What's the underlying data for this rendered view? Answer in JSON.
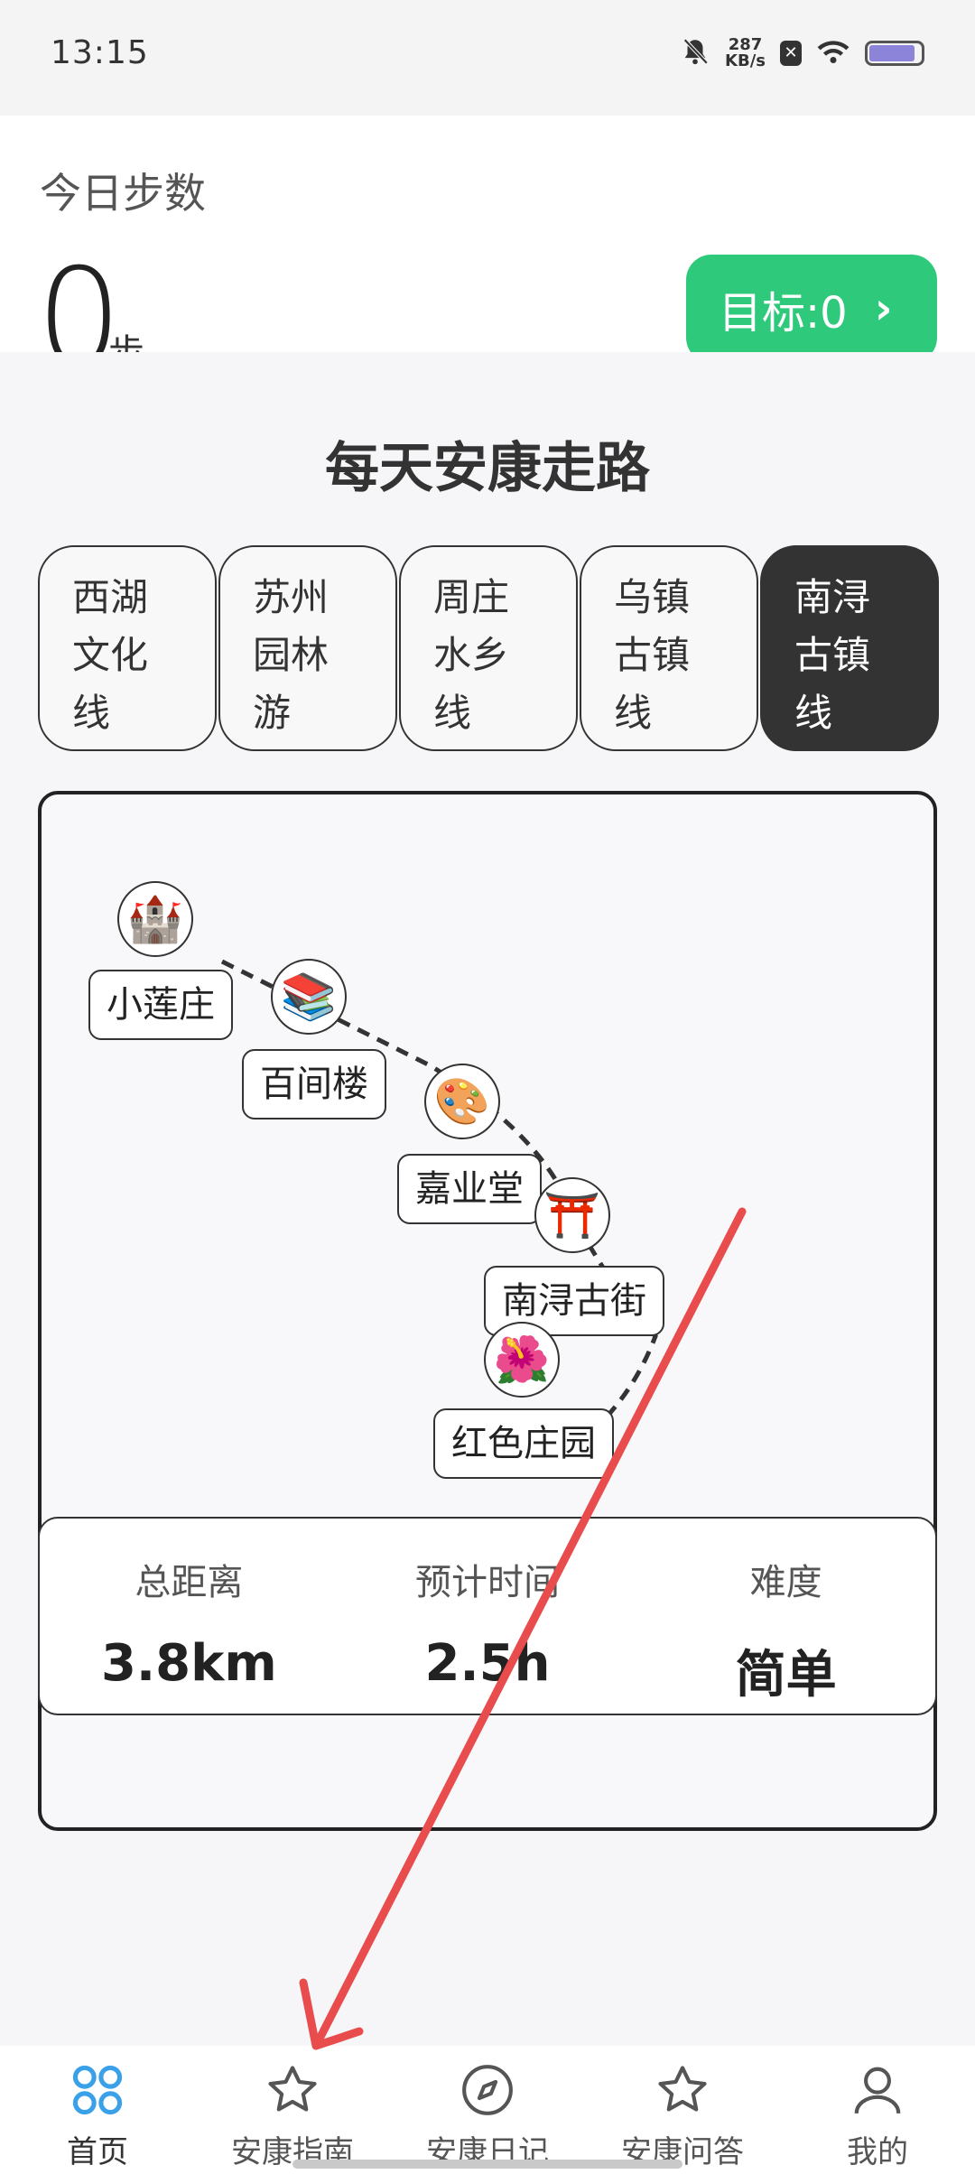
{
  "status_bar": {
    "time": "13:15",
    "net_speed_value": "287",
    "net_speed_unit": "KB/s",
    "icons": [
      "bell-muted-icon",
      "app-notification-icon",
      "wifi-icon",
      "battery-icon"
    ]
  },
  "steps": {
    "title": "今日步数",
    "count": "0",
    "unit": "步",
    "goal_label": "目标:0",
    "goal_chevron": "›"
  },
  "route": {
    "title": "每天安康走路",
    "tabs": [
      {
        "label": "西湖\n文化\n线",
        "active": false
      },
      {
        "label": "苏州\n园林\n游",
        "active": false
      },
      {
        "label": "周庄\n水乡\n线",
        "active": false
      },
      {
        "label": "乌镇\n古镇\n线",
        "active": false
      },
      {
        "label": "南浔\n古镇\n线",
        "active": true
      }
    ],
    "stops": [
      {
        "name": "小莲庄",
        "icon": "🏰",
        "icon_name": "castle-icon"
      },
      {
        "name": "百间楼",
        "icon": "📚",
        "icon_name": "books-icon"
      },
      {
        "name": "嘉业堂",
        "icon": "🎨",
        "icon_name": "palette-icon"
      },
      {
        "name": "南浔古街",
        "icon": "⛩️",
        "icon_name": "torii-gate-icon"
      },
      {
        "name": "红色庄园",
        "icon": "🌺",
        "icon_name": "hibiscus-icon"
      }
    ],
    "stats": [
      {
        "label": "总距离",
        "value": "3.8km"
      },
      {
        "label": "预计时间",
        "value": "2.5h"
      },
      {
        "label": "难度",
        "value": "简单"
      }
    ]
  },
  "nav": {
    "items": [
      {
        "label": "首页",
        "icon": "grid-icon",
        "active": true
      },
      {
        "label": "安康指南",
        "icon": "star-icon",
        "active": false
      },
      {
        "label": "安康日记",
        "icon": "compass-icon",
        "active": false
      },
      {
        "label": "安康问答",
        "icon": "star-icon",
        "active": false
      },
      {
        "label": "我的",
        "icon": "person-icon",
        "active": false
      }
    ]
  },
  "colors": {
    "accent_green": "#2fc97b",
    "active_tab": "#333333",
    "home_icon_blue": "#3aa0e8",
    "annotation_red": "#e84c4c"
  }
}
